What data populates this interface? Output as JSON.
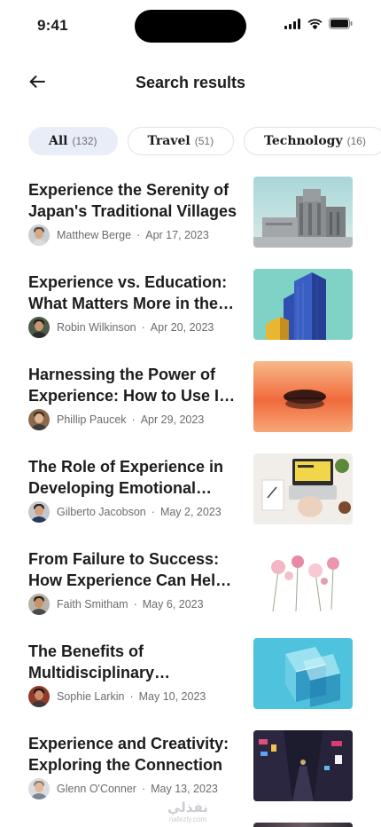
{
  "status_bar": {
    "time": "9:41"
  },
  "header": {
    "title": "Search results",
    "back_icon": "arrow-left-icon"
  },
  "filters": [
    {
      "label": "All",
      "count": "(132)",
      "active": true
    },
    {
      "label": "Travel",
      "count": "(51)",
      "active": false
    },
    {
      "label": "Technology",
      "count": "(16)",
      "active": false
    }
  ],
  "results": [
    {
      "title": "Experience the Serenity of Japan's Traditional Villages",
      "author": "Matthew Berge",
      "date": "Apr 17, 2023",
      "thumbnail": "concrete-building-photo"
    },
    {
      "title": "Experience vs. Education: What Matters More in the Workplace",
      "author": "Robin Wilkinson",
      "date": "Apr 20, 2023",
      "thumbnail": "blue-skyscraper-photo"
    },
    {
      "title": "Harnessing the Power of Experience: How to Use It Effectively",
      "author": "Phillip Paucek",
      "date": "Apr 29, 2023",
      "thumbnail": "sunset-lake-photo"
    },
    {
      "title": "The Role of Experience in Developing Emotional Intelligence",
      "author": "Gilberto Jacobson",
      "date": "May 2, 2023",
      "thumbnail": "laptop-desk-photo"
    },
    {
      "title": "From Failure to Success: How Experience Can Help You Grow",
      "author": "Faith Smitham",
      "date": "May 6, 2023",
      "thumbnail": "pressed-flowers-photo"
    },
    {
      "title": "The Benefits of Multidisciplinary Experience",
      "author": "Sophie Larkin",
      "date": "May 10, 2023",
      "thumbnail": "glass-cubes-photo"
    },
    {
      "title": "Experience and Creativity: Exploring the Connection",
      "author": "Glenn O'Conner",
      "date": "May 13, 2023",
      "thumbnail": "night-street-photo"
    }
  ],
  "watermark": {
    "main": "نفذلي",
    "sub": "nafezly.com"
  },
  "colors": {
    "active_chip_bg": "#e9edf7",
    "text_primary": "#1c1c1c",
    "text_secondary": "#6b6b72"
  }
}
